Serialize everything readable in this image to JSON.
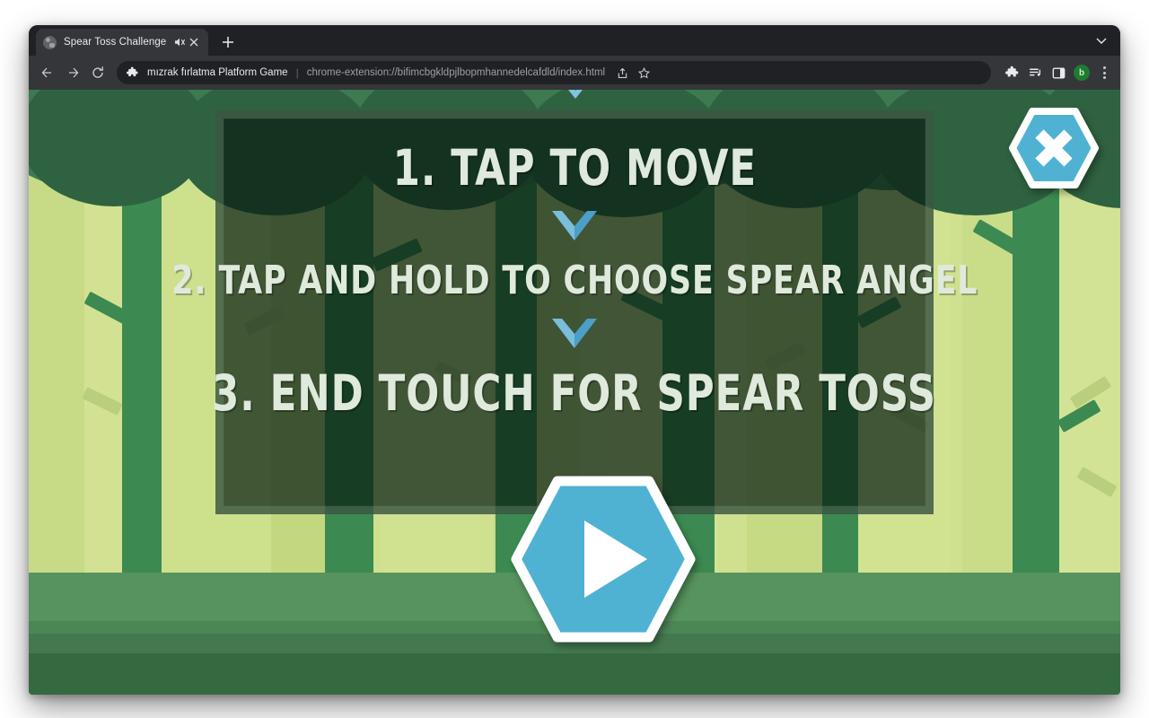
{
  "browser": {
    "tab": {
      "title": "Spear Toss Challenge",
      "favicon_icon": "globe-icon",
      "mute_icon": "speaker-mute-icon",
      "close_icon": "close-icon"
    },
    "newtab_icon": "plus-icon",
    "window_chevron_icon": "chevron-down-icon",
    "nav": {
      "back_icon": "arrow-back-icon",
      "forward_icon": "arrow-forward-icon",
      "reload_icon": "reload-icon"
    },
    "omnibox": {
      "extension_icon": "puzzle-piece-icon",
      "extension_name": "mızrak fırlatma Platform Game",
      "separator": "|",
      "url": "chrome-extension://bifimcbgkldpjlbopmhannedelcafdld/index.html",
      "share_icon": "share-icon",
      "bookmark_icon": "star-icon"
    },
    "toolbar": {
      "extensions_icon": "puzzle-piece-icon",
      "media_icon": "playlist-music-icon",
      "sidepanel_icon": "side-panel-icon",
      "avatar_label": "b",
      "avatar_color": "#1e7b32",
      "menu_icon": "kebab-menu-icon"
    }
  },
  "game": {
    "title": "Spear Toss Challenge",
    "instructions": [
      {
        "id": 1,
        "text": "1. TAP TO MOVE"
      },
      {
        "id": 2,
        "text": "2. TAP AND HOLD TO CHOOSE SPEAR ANGEL"
      },
      {
        "id": 3,
        "text": "3. END TOUCH FOR SPEAR TOSS"
      }
    ],
    "chevron_icon": "chevron-down-icon",
    "play_button": {
      "icon": "play-triangle-icon",
      "shape": "hexagon",
      "fill": "#4fb2d3",
      "border": "#ffffff"
    },
    "close_button": {
      "icon": "close-x-icon",
      "shape": "hexagon",
      "fill": "#4fb2d3",
      "border": "#ffffff"
    },
    "colors": {
      "canopy_dark": "#1d4430",
      "canopy_mid": "#3d7a4f",
      "trunk_light": "#cfe08f",
      "trunk_mid": "#3c8a52",
      "ground_top": "#56935e",
      "ground_bottom": "#35693f",
      "panel_overlay": "rgba(10,32,20,0.72)",
      "text": "#dfe9dc",
      "accent_blue": "#4fb2d3"
    }
  }
}
